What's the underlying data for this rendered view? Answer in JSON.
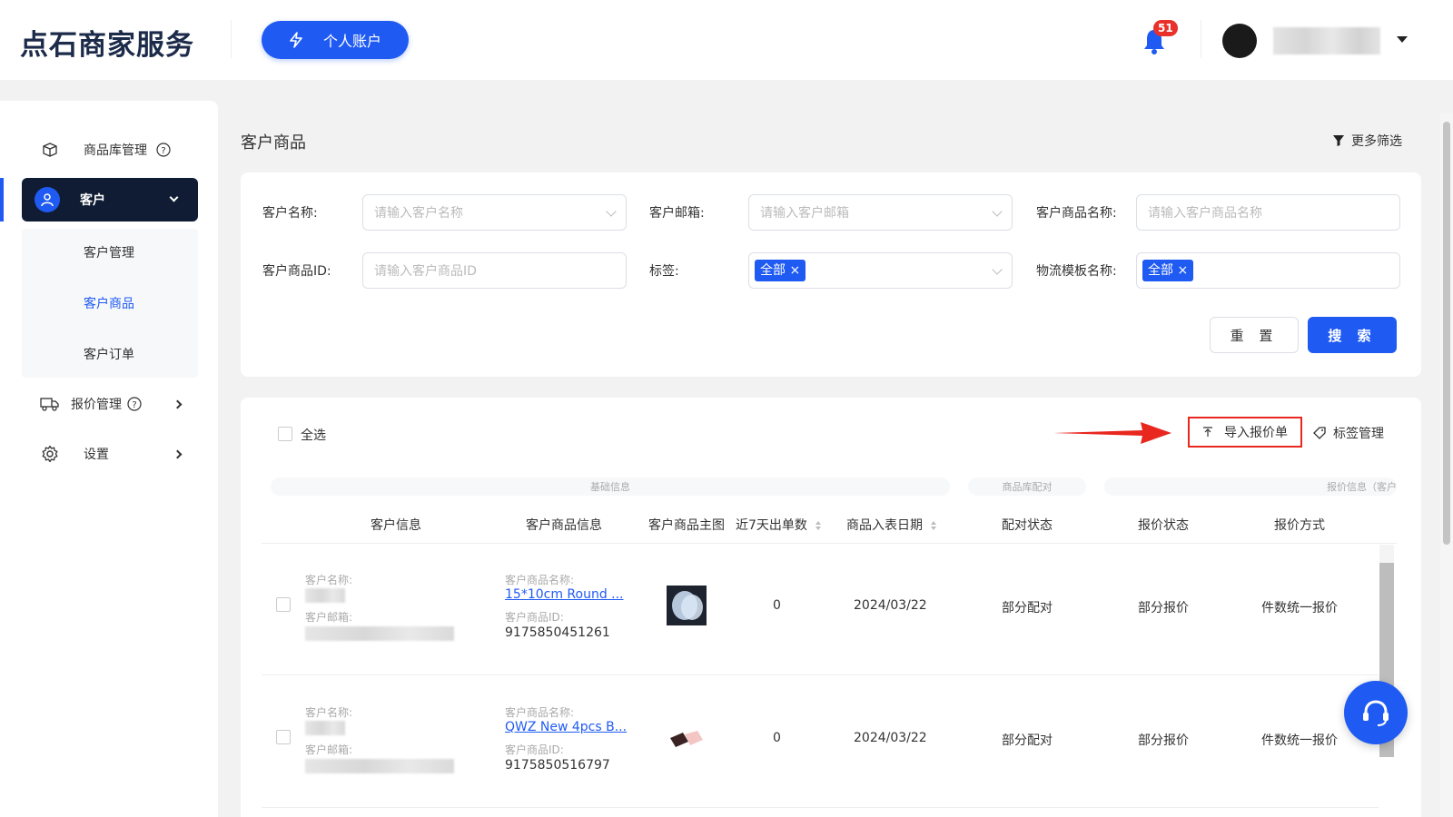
{
  "header": {
    "logo": "点石商家服务",
    "account_button": "个人账户",
    "notification_count": "51"
  },
  "sidebar": {
    "items": [
      {
        "label": "商品库管理"
      },
      {
        "label": "客户"
      },
      {
        "label": "报价管理"
      },
      {
        "label": "设置"
      }
    ],
    "sub_items": [
      {
        "label": "客户管理"
      },
      {
        "label": "客户商品"
      },
      {
        "label": "客户订单"
      }
    ],
    "active_color": "#1f5af2"
  },
  "main": {
    "title": "客户商品",
    "more_filter": "更多筛选",
    "filters": {
      "customer_name": {
        "label": "客户名称:",
        "placeholder": "请输入客户名称"
      },
      "customer_email": {
        "label": "客户邮箱:",
        "placeholder": "请输入客户邮箱"
      },
      "product_name": {
        "label": "客户商品名称:",
        "placeholder": "请输入客户商品名称"
      },
      "product_id": {
        "label": "客户商品ID:",
        "placeholder": "请输入客户商品ID"
      },
      "tags": {
        "label": "标签:",
        "value": "全部"
      },
      "shipping_template": {
        "label": "物流模板名称:",
        "value": "全部"
      }
    },
    "reset_button": "重 置",
    "search_button": "搜 索"
  },
  "table": {
    "select_all": "全选",
    "import_button": "导入报价单",
    "tag_manage": "标签管理",
    "groups": [
      "基础信息",
      "商品库配对",
      "报价信息（客户"
    ],
    "columns": [
      "客户信息",
      "客户商品信息",
      "客户商品主图",
      "近7天出单数",
      "商品入表日期",
      "配对状态",
      "报价状态",
      "报价方式"
    ],
    "field_labels": {
      "customer_name": "客户名称:",
      "customer_email": "客户邮箱:",
      "product_name": "客户商品名称:",
      "product_id": "客户商品ID:"
    },
    "rows": [
      {
        "product_name": "15*10cm Round ...",
        "product_id": "9175850451261",
        "orders_7d": "0",
        "date": "2024/03/22",
        "match_status": "部分配对",
        "quote_status": "部分报价",
        "quote_method": "件数统一报价"
      },
      {
        "product_name": "QWZ New 4pcs B...",
        "product_id": "9175850516797",
        "orders_7d": "0",
        "date": "2024/03/22",
        "match_status": "部分配对",
        "quote_status": "部分报价",
        "quote_method": "件数统一报价"
      }
    ]
  },
  "colors": {
    "primary": "#1f5af2",
    "nav_dark": "#0f1c33",
    "annotation_red": "#e8271e"
  }
}
